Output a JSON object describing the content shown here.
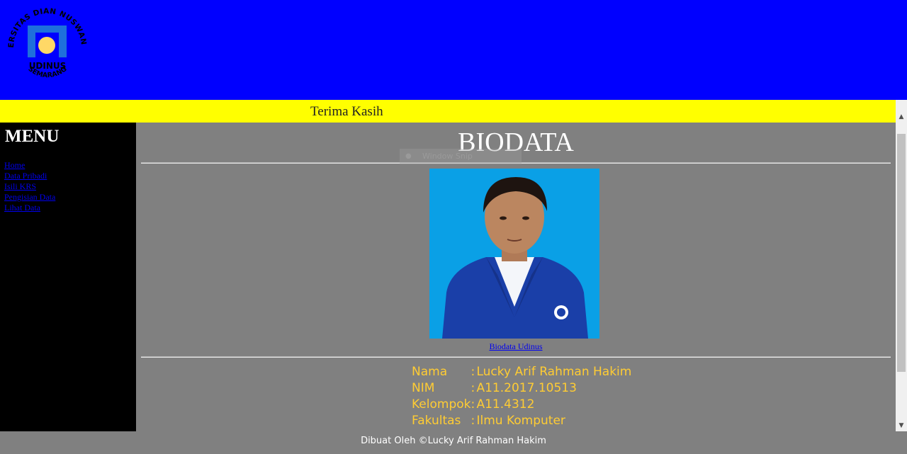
{
  "header": {
    "logo": {
      "ring_text": "UNIVERSITAS DIAN NUSWANTORO",
      "bottom_text": "SEMARANG",
      "brand": "UDINUS"
    }
  },
  "marquee": {
    "text": "Terima Kasih"
  },
  "sidebar": {
    "title": "MENU",
    "links": [
      "Home",
      "Data Pribadi",
      "Isili KRS",
      "Pengisian Data",
      "Lihat Data"
    ]
  },
  "main": {
    "title": "BIODATA",
    "photo_caption": "Biodata Udinus",
    "window_snip": "Window Snip",
    "fields": [
      {
        "label": "Nama",
        "sep": ":",
        "value": "Lucky Arif Rahman Hakim"
      },
      {
        "label": "NIM",
        "sep": ":",
        "value": "A11.2017.10513"
      },
      {
        "label": "Kelompok",
        "sep": ":",
        "value": "A11.4312"
      },
      {
        "label": "Fakultas",
        "sep": ":",
        "value": "Ilmu Komputer"
      }
    ]
  },
  "footer": {
    "text": "Dibuat Oleh ©Lucky Arif Rahman Hakim"
  },
  "colors": {
    "header_bg": "#0000ff",
    "marquee_bg": "#ffff00",
    "sidebar_bg": "#000000",
    "content_bg": "#808080",
    "field_text": "#ffcc33"
  }
}
